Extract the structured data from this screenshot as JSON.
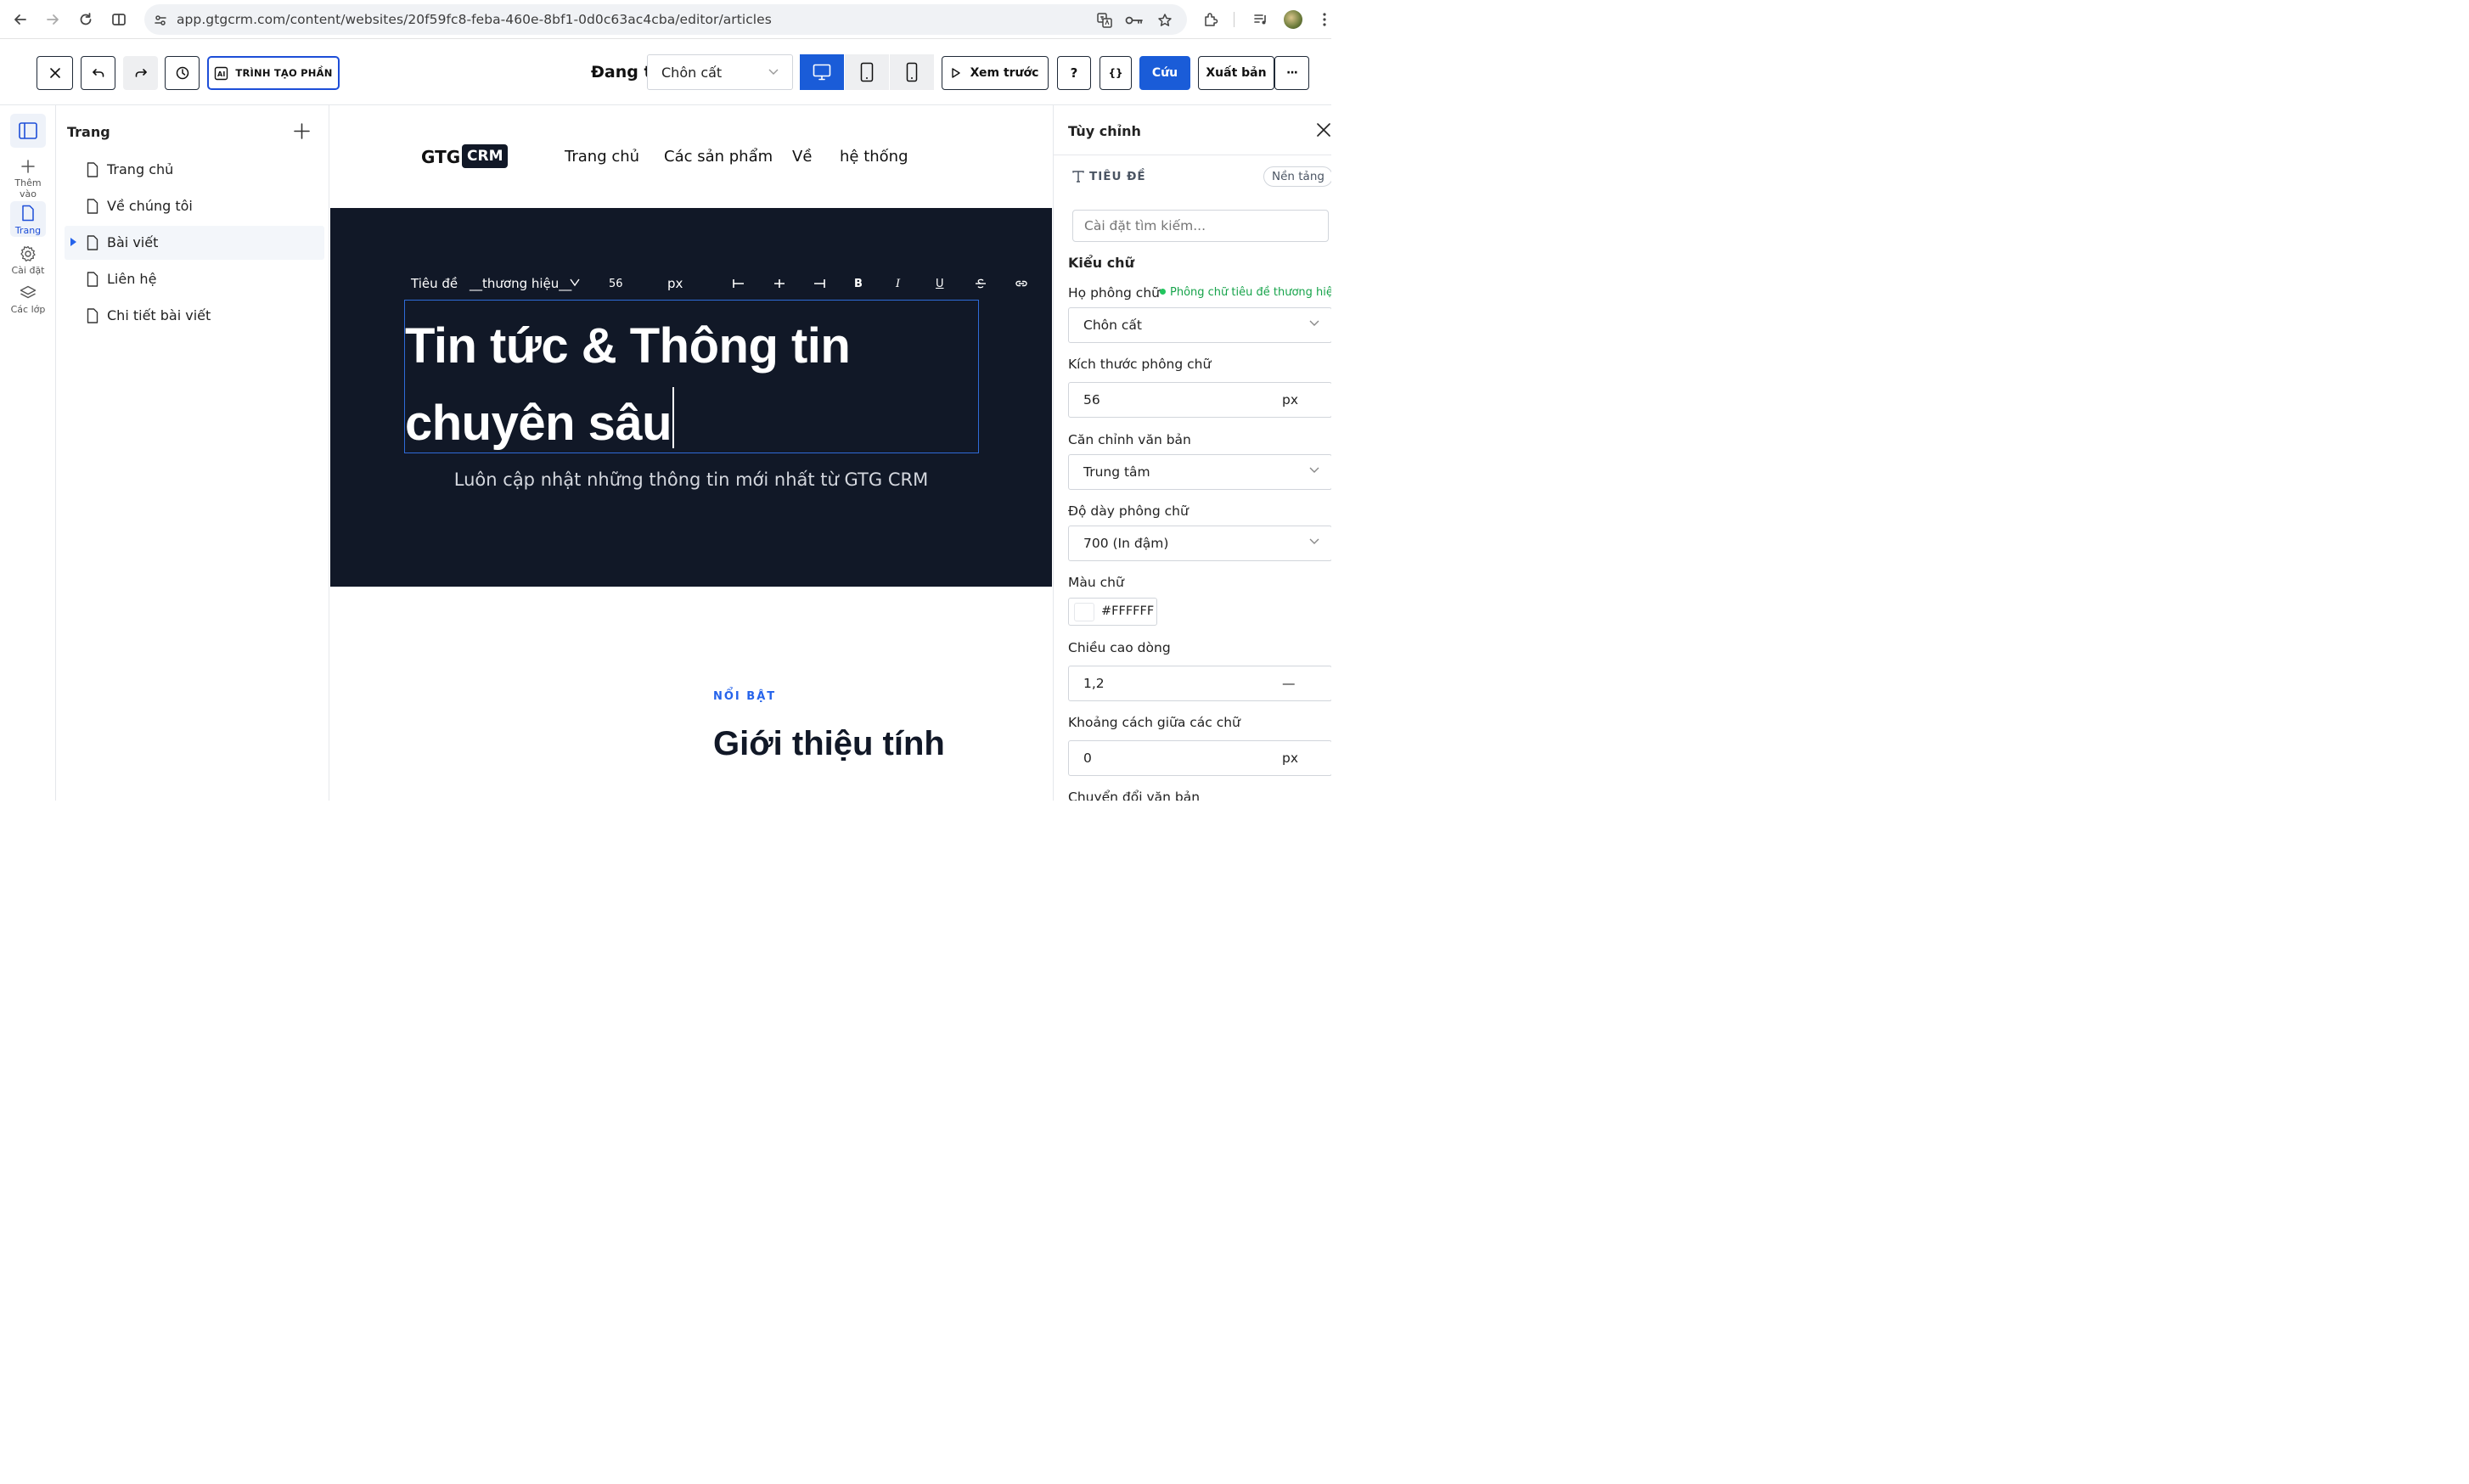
{
  "browser": {
    "url": "app.gtgcrm.com/content/websites/20f59fc8-feba-460e-8bf1-0d0c63ac4cba/editor/articles"
  },
  "toolbar": {
    "section_builder_label": "TRÌNH TẠO PHẦN",
    "status_text": "Đang t",
    "theme_value": "Chôn cất",
    "preview_label": "Xem trước",
    "help_label": "?",
    "code_label": "{}",
    "save_label": "Cứu",
    "publish_label": "Xuất bản",
    "more_label": "···"
  },
  "rail": {
    "add_label": "Thêm vào",
    "pages_label": "Trang",
    "settings_label": "Cài đặt",
    "layers_label": "Các lớp"
  },
  "pages_panel": {
    "title": "Trang",
    "items": [
      {
        "label": "Trang chủ"
      },
      {
        "label": "Về chúng tôi"
      },
      {
        "label": "Bài viết"
      },
      {
        "label": "Liên hệ"
      },
      {
        "label": "Chi tiết bài viết"
      }
    ]
  },
  "site": {
    "logo_text": "GTG",
    "logo_badge": "CRM",
    "nav": [
      "Trang chủ",
      "Các sản phẩm",
      "Về",
      "hệ thống"
    ],
    "format_bar": {
      "element_label": "Tiêu đề",
      "font_label": "__thương hiệu__",
      "size": "56",
      "unit": "px",
      "bold": "B",
      "italic": "I",
      "underline": "U"
    },
    "hero_title_line1": "Tin tức & Thông tin",
    "hero_title_line2": "chuyên sâu",
    "hero_subtitle": "Luôn cập nhật những thông tin mới nhất từ GTG CRM",
    "featured_eyebrow": "NỔI BẬT",
    "featured_title": "Giới thiệu tính"
  },
  "customize": {
    "title": "Tùy chỉnh",
    "element_type": "TIÊU ĐỀ",
    "platform_badge": "Nền tảng",
    "search_placeholder": "Cài đặt tìm kiếm...",
    "typography_heading": "Kiểu chữ",
    "font_family_label": "Họ phông chữ",
    "font_family_indicator": "Phông chữ tiêu đề thương hiệu",
    "font_family_value": "Chôn cất",
    "font_size_label": "Kích thước phông chữ",
    "font_size_value": "56",
    "font_size_unit": "px",
    "text_align_label": "Căn chỉnh văn bản",
    "text_align_value": "Trung tâm",
    "font_weight_label": "Độ dày phông chữ",
    "font_weight_value": "700 (In đậm)",
    "text_color_label": "Màu chữ",
    "text_color_value": "#FFFFFF",
    "line_height_label": "Chiều cao dòng",
    "line_height_value": "1,2",
    "line_height_unit": "—",
    "letter_spacing_label": "Khoảng cách giữa các chữ",
    "letter_spacing_value": "0",
    "letter_spacing_unit": "px",
    "text_transform_label": "Chuyển đổi văn bản"
  },
  "colors": {
    "accent": "#1a5cd8",
    "hero_bg": "#111827",
    "indicator_green": "#16a34a"
  }
}
